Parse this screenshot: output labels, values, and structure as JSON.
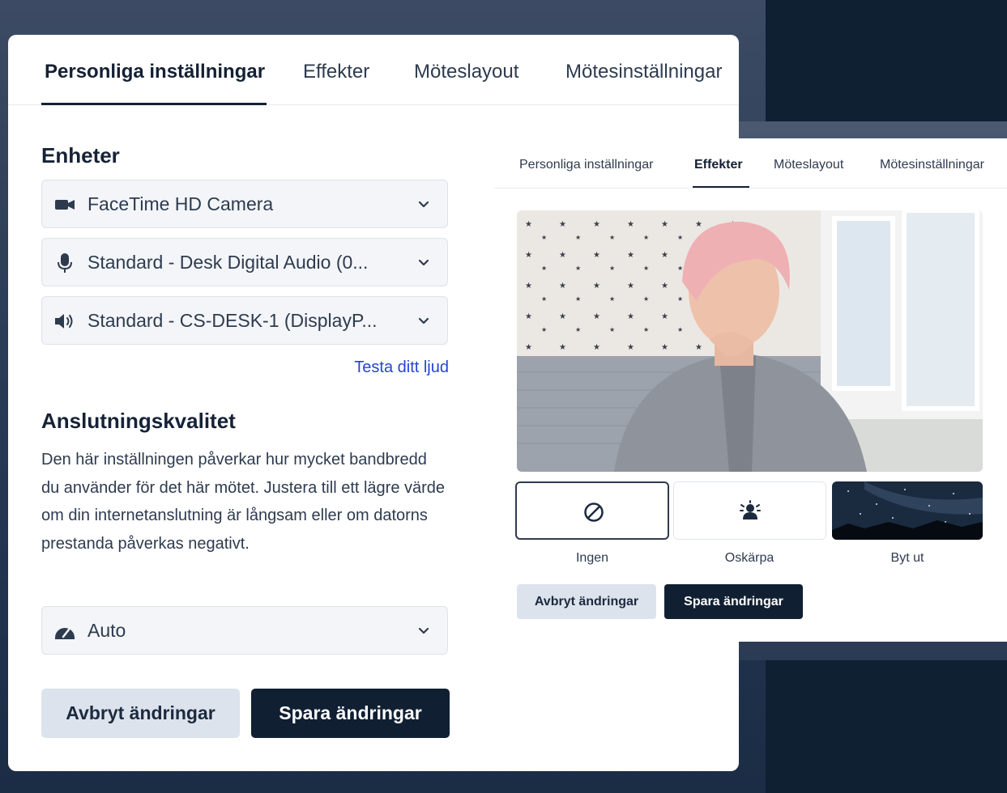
{
  "main": {
    "tabs": [
      {
        "label": "Personliga inställningar",
        "active": true
      },
      {
        "label": "Effekter",
        "active": false
      },
      {
        "label": "Möteslayout",
        "active": false
      },
      {
        "label": "Mötesinställningar",
        "active": false
      }
    ],
    "devices": {
      "title": "Enheter",
      "camera": {
        "value": "FaceTime HD Camera",
        "icon": "camera-icon"
      },
      "microphone": {
        "value": "Standard - Desk Digital Audio (0...",
        "icon": "microphone-icon"
      },
      "speaker": {
        "value": "Standard - CS-DESK-1 (DisplayP...",
        "icon": "speaker-icon"
      },
      "test_audio_link": "Testa ditt ljud"
    },
    "connection": {
      "title": "Anslutningskvalitet",
      "description": "Den här inställningen påverkar hur mycket bandbredd du använder för det här mötet. Justera till ett lägre värde om din internetanslutning är långsam eller om datorns prestanda påverkas negativt.",
      "quality": {
        "value": "Auto",
        "icon": "speedometer-icon"
      }
    },
    "actions": {
      "cancel": "Avbryt ändringar",
      "save": "Spara ändringar"
    }
  },
  "overlay": {
    "tabs": [
      {
        "label": "Personliga inställningar",
        "active": false
      },
      {
        "label": "Effekter",
        "active": true
      },
      {
        "label": "Möteslayout",
        "active": false
      },
      {
        "label": "Mötesinställningar",
        "active": false
      }
    ],
    "effects": [
      {
        "label": "Ingen",
        "icon": "no-effect-icon",
        "selected": true
      },
      {
        "label": "Oskärpa",
        "icon": "blur-icon",
        "selected": false
      },
      {
        "label": "Byt ut",
        "icon": "background-image",
        "selected": false
      }
    ],
    "actions": {
      "cancel": "Avbryt ändringar",
      "save": "Spara ändringar"
    }
  },
  "colors": {
    "primary_button": "#111f33",
    "secondary_button": "#dde3ec",
    "link": "#2345d6",
    "page_background": "#0f2033"
  }
}
